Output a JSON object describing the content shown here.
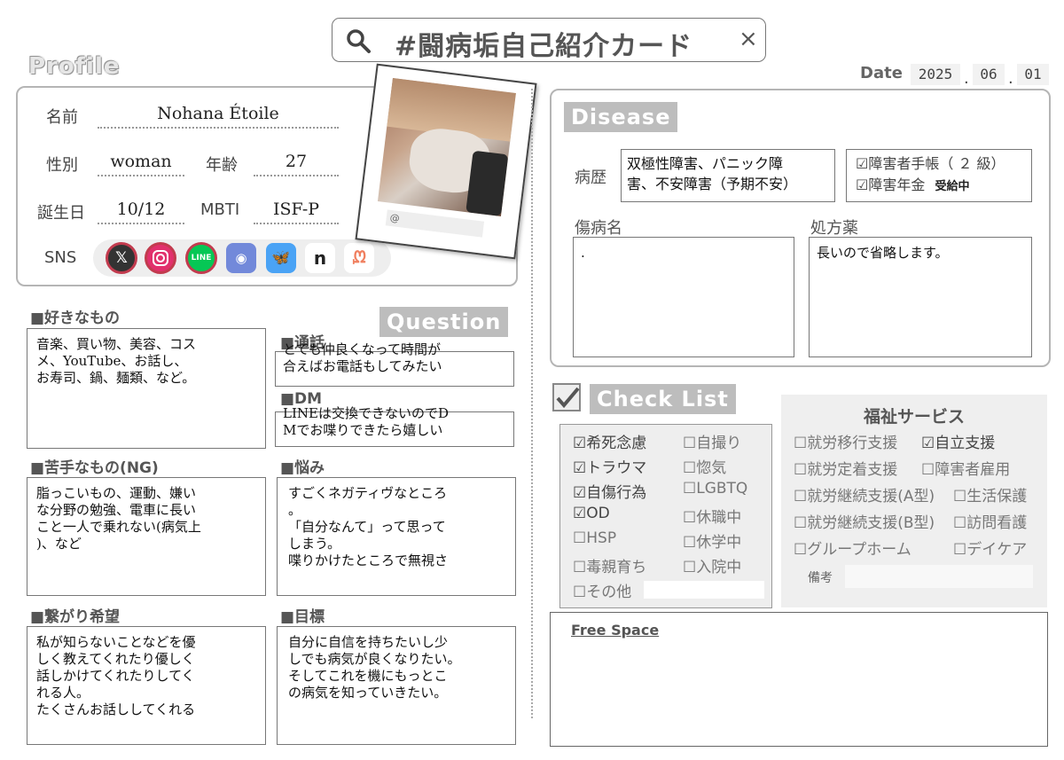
{
  "search": {
    "query": "#闘病垢自己紹介カード",
    "clear": "×"
  },
  "profile": {
    "title": "Profile",
    "name_label": "名前",
    "name": "Nohana Étoile",
    "gender_label": "性別",
    "gender": "woman",
    "age_label": "年齢",
    "age": "27",
    "birthday_label": "誕生日",
    "birthday": "10/12",
    "mbti_label": "MBTI",
    "mbti": "ISF-P",
    "sns_label": "SNS",
    "sns": [
      "X",
      "Instagram",
      "LINE",
      "Discord",
      "Bluesky",
      "note",
      "Misskey"
    ],
    "handle": "@"
  },
  "date": {
    "label": "Date",
    "year": "2025",
    "month": "06",
    "day": "01"
  },
  "likes": {
    "title": "■好きなもの",
    "text": "音楽、買い物、美容、コス\nメ、YouTube、お話し、\nお寿司、鍋、麺類、など。"
  },
  "dislikes": {
    "title": "■苦手なもの(NG)",
    "text": "脂っこいもの、運動、嫌い\nな分野の勉強、電車に長い\nこと一人で乗れない(病気上\n)、など"
  },
  "connect": {
    "title": "■繋がり希望",
    "text": "私が知らないことなどを優\nしく教えてくれたり優しく\n話しかけてくれたりしてく\nれる人。\nたくさんお話ししてくれる"
  },
  "question": {
    "title": "Question",
    "call_title": "■通話",
    "call_text": "とても仲良くなって時間が\n合えばお電話もしてみたい",
    "dm_title": "■DM",
    "dm_text": "LINEは交換できないのでD\nMでお喋りできたら嬉しい",
    "worry_title": "■悩み",
    "worry_text": "すごくネガティヴなところ\n。\n「自分なんて」って思って\nしまう。\n喋りかけたところで無視さ",
    "goal_title": "■目標",
    "goal_text": "自分に自信を持ちたいし少\nしでも病気が良くなりたい。\nそしてこれを機にもっとこ\nの病気を知っていきたい。"
  },
  "disease": {
    "title": "Disease",
    "history_label": "病歴",
    "history_text": "双極性障害、パニック障\n害、不安障害（予期不安）",
    "techo": "☑障害者手帳（ ２ 級）",
    "nenkin": "☑障害年金",
    "nenkin_note": "受給中",
    "injury_label": "傷病名",
    "injury_text": ".",
    "meds_label": "処方薬",
    "meds_text": "長いので省略します。"
  },
  "checklist": {
    "title": "Check List",
    "left": [
      "☑希死念慮",
      "☑トラウマ",
      "☑自傷行為",
      "☑OD",
      "☐HSP",
      "☐毒親育ち",
      "☐その他"
    ],
    "right": [
      "☐自撮り",
      "☐惚気",
      "☐LGBTQ",
      "☐休職中",
      "☐休学中",
      "☐入院中"
    ]
  },
  "welfare": {
    "title": "福祉サービス",
    "rows": [
      [
        "☐就労移行支援",
        "☑自立支援"
      ],
      [
        "☐就労定着支援",
        "☐障害者雇用"
      ],
      [
        "☐就労継続支援(A型)",
        "☐生活保護"
      ],
      [
        "☐就労継続支援(B型)",
        "☐訪問看護"
      ],
      [
        "☐グループホーム",
        "☐デイケア"
      ]
    ],
    "note_label": "備考"
  },
  "free": {
    "title": "Free Space"
  }
}
